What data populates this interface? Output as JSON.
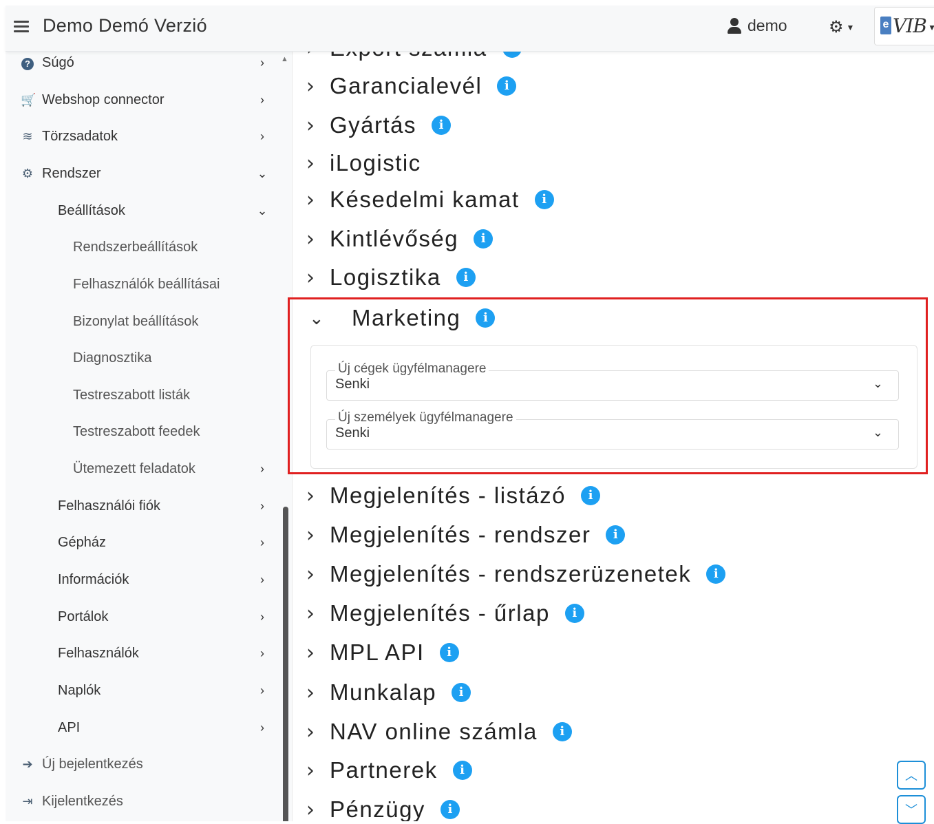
{
  "header": {
    "title": "Demo Demó Verzió",
    "user": "demo",
    "logo_e": "e",
    "logo_text": "VIB"
  },
  "sidebar": {
    "items": [
      {
        "label": "Súgó"
      },
      {
        "label": "Webshop connector"
      },
      {
        "label": "Törzsadatok"
      },
      {
        "label": "Rendszer"
      },
      {
        "label": "Beállítások"
      },
      {
        "label": "Rendszerbeállítások"
      },
      {
        "label": "Felhasználók beállításai"
      },
      {
        "label": "Bizonylat beállítások"
      },
      {
        "label": "Diagnosztika"
      },
      {
        "label": "Testreszabott listák"
      },
      {
        "label": "Testreszabott feedek"
      },
      {
        "label": "Ütemezett feladatok"
      },
      {
        "label": "Felhasználói fiók"
      },
      {
        "label": "Gépház"
      },
      {
        "label": "Információk"
      },
      {
        "label": "Portálok"
      },
      {
        "label": "Felhasználók"
      },
      {
        "label": "Naplók"
      },
      {
        "label": "API"
      },
      {
        "label": "Új bejelentkezés"
      },
      {
        "label": "Kijelentkezés"
      }
    ]
  },
  "sections": {
    "top_partial": "Export számla",
    "before": [
      "Garancialevél",
      "Gyártás",
      "iLogistic",
      "Késedelmi kamat",
      "Kintlévőség",
      "Logisztika"
    ],
    "marketing": {
      "title": "Marketing",
      "fields": [
        {
          "label": "Új cégek ügyfélmanagere",
          "value": "Senki"
        },
        {
          "label": "Új személyek ügyfélmanagere",
          "value": "Senki"
        }
      ]
    },
    "after": [
      "Megjelenítés - listázó",
      "Megjelenítés - rendszer",
      "Megjelenítés - rendszerüzenetek",
      "Megjelenítés - űrlap",
      "MPL API",
      "Munkalap",
      "NAV online számla",
      "Partnerek",
      "Pénzügy"
    ]
  },
  "icons": {
    "info": "info-icon",
    "accent": "#1da0f2",
    "highlight": "#e02020"
  }
}
